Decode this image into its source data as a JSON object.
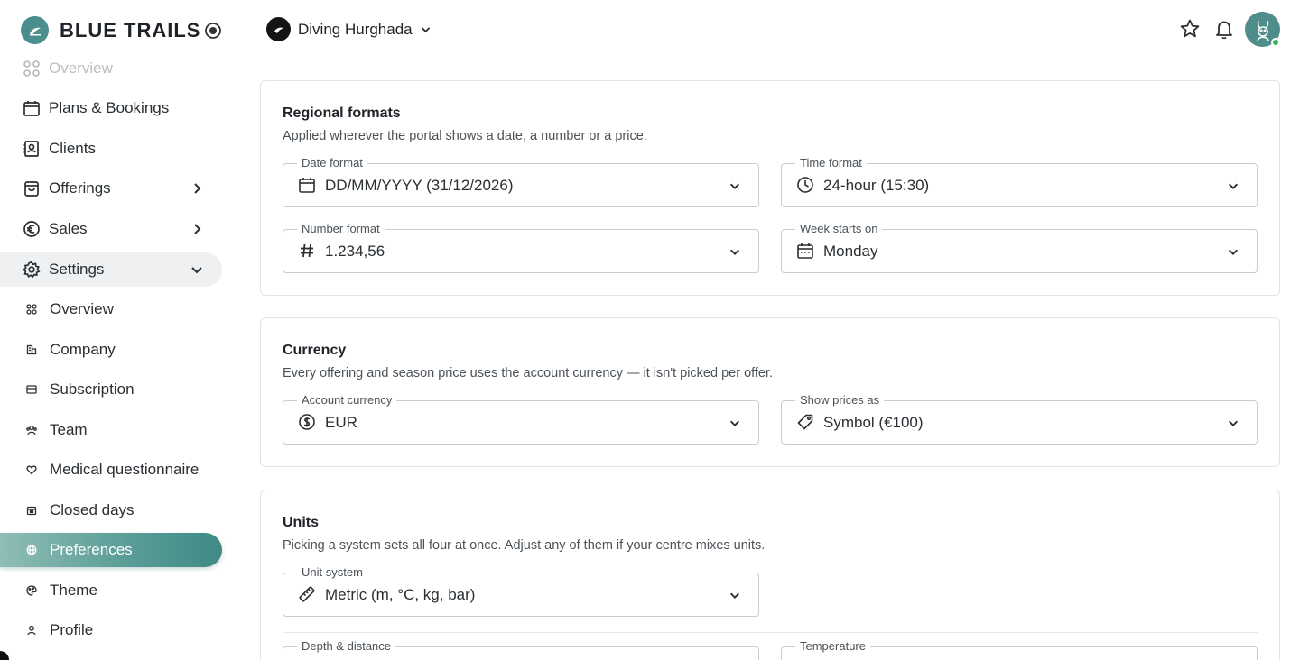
{
  "brand": {
    "name": "BLUE TRAILS"
  },
  "workspace": {
    "name": "Diving Hurghada"
  },
  "nav": {
    "items": [
      {
        "label": "Overview",
        "icon": "grid-icon"
      },
      {
        "label": "Plans & Bookings",
        "icon": "calendar-icon"
      },
      {
        "label": "Clients",
        "icon": "contacts-icon"
      },
      {
        "label": "Offerings",
        "icon": "bag-icon"
      },
      {
        "label": "Sales",
        "icon": "euro-icon"
      },
      {
        "label": "Settings",
        "icon": "gear-icon"
      }
    ],
    "settings_sub": [
      {
        "label": "Overview",
        "icon": "grid-icon"
      },
      {
        "label": "Company",
        "icon": "building-icon"
      },
      {
        "label": "Subscription",
        "icon": "card-icon"
      },
      {
        "label": "Team",
        "icon": "team-icon"
      },
      {
        "label": "Medical questionnaire",
        "icon": "heart-icon"
      },
      {
        "label": "Closed days",
        "icon": "calendar-icon"
      },
      {
        "label": "Preferences",
        "icon": "globe-icon"
      },
      {
        "label": "Theme",
        "icon": "palette-icon"
      },
      {
        "label": "Profile",
        "icon": "person-icon"
      }
    ]
  },
  "regional": {
    "title": "Regional formats",
    "description": "Applied wherever the portal shows a date, a number or a price.",
    "date_format": {
      "label": "Date format",
      "value": "DD/MM/YYYY (31/12/2026)"
    },
    "time_format": {
      "label": "Time format",
      "value": "24-hour (15:30)"
    },
    "number_format": {
      "label": "Number format",
      "value": "1.234,56"
    },
    "week_start": {
      "label": "Week starts on",
      "value": "Monday"
    }
  },
  "currency": {
    "title": "Currency",
    "description": "Every offering and season price uses the account currency — it isn't picked per offer.",
    "account_currency": {
      "label": "Account currency",
      "value": "EUR"
    },
    "show_prices": {
      "label": "Show prices as",
      "value": "Symbol (€100)"
    }
  },
  "units": {
    "title": "Units",
    "description": "Picking a system sets all four at once. Adjust any of them if your centre mixes units.",
    "unit_system": {
      "label": "Unit system",
      "value": "Metric (m, °C, kg, bar)"
    },
    "depth": {
      "label": "Depth & distance",
      "value": ""
    },
    "temperature": {
      "label": "Temperature",
      "value": ""
    }
  },
  "colors": {
    "accent": "#4a8f8d",
    "active_gradient_start": "#8fbdb6",
    "active_gradient_end": "#3e8a86",
    "online_status": "#3cb55a"
  }
}
